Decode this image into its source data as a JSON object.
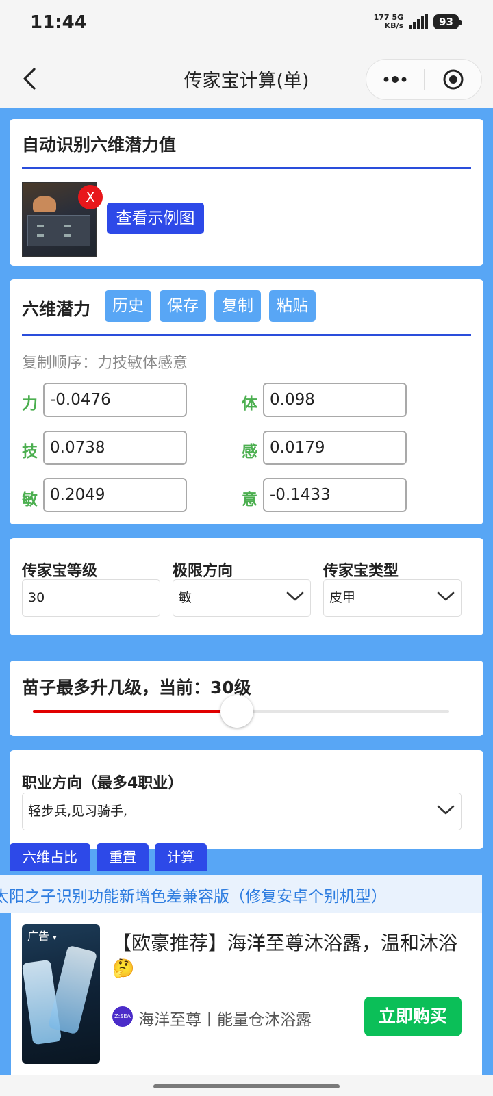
{
  "status": {
    "time": "11:44",
    "net_speed": "177",
    "net_unit": "KB/s",
    "net_type": "5G",
    "battery": "93"
  },
  "header": {
    "title": "传家宝计算(单)",
    "back_icon": "chevron-left-icon",
    "more_icon": "more-dots-icon",
    "close_icon": "target-close-icon"
  },
  "recognize": {
    "title": "自动识别六维潜力值",
    "remove_label": "X",
    "example_button": "查看示例图"
  },
  "potential": {
    "title": "六维潜力",
    "buttons": [
      "历史",
      "保存",
      "复制",
      "粘贴"
    ],
    "hint": "复制顺序：力技敏体感意",
    "fields": [
      {
        "label": "力",
        "value": "-0.0476"
      },
      {
        "label": "技",
        "value": "0.0738"
      },
      {
        "label": "敏",
        "value": "0.2049"
      },
      {
        "label": "体",
        "value": "0.098"
      },
      {
        "label": "感",
        "value": "0.0179"
      },
      {
        "label": "意",
        "value": "-0.1433"
      }
    ]
  },
  "settings": {
    "level_label": "传家宝等级",
    "level_value": "30",
    "direction_label": "极限方向",
    "direction_value": "敏",
    "type_label": "传家宝类型",
    "type_value": "皮甲"
  },
  "slider": {
    "label": "苗子最多升几级，当前：30级",
    "fraction": 0.49,
    "accent_color": "#e10000"
  },
  "career": {
    "label": "职业方向（最多4职业）",
    "value": "轻步兵,见习骑手,"
  },
  "bottom_buttons": [
    "六维占比",
    "重置",
    "计算"
  ],
  "notice": "太阳之子识别功能新增色差兼容版（修复安卓个别机型）",
  "ad": {
    "tag": "广告",
    "title": "【欧豪推荐】海洋至尊沐浴露，温和沐浴",
    "emoji": "🤔",
    "logo_text": "Z:SEA",
    "brand": "海洋至尊丨能量仓沐浴露",
    "cta": "立即购买"
  },
  "colors": {
    "page_bg": "#58a6f5",
    "primary_button": "#2d49e8",
    "secondary_button": "#58a6f5",
    "label_green": "#4caf50",
    "cta_green": "#0bbf58"
  }
}
